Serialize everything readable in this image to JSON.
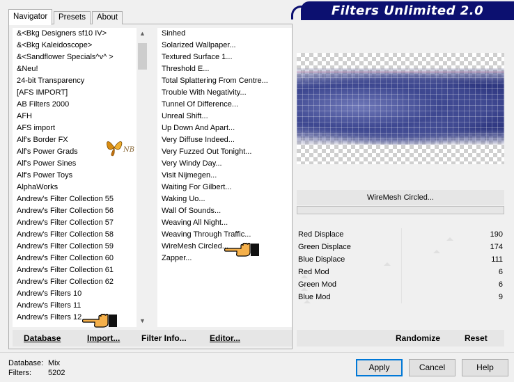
{
  "header": {
    "title": "Filters Unlimited 2.0"
  },
  "tabs": [
    {
      "label": "Navigator",
      "active": true
    },
    {
      "label": "Presets",
      "active": false
    },
    {
      "label": "About",
      "active": false
    }
  ],
  "categories": [
    "&<Bkg Designers sf10 IV>",
    "&<Bkg Kaleidoscope>",
    "&<Sandflower Specials^v^ >",
    "&Neu!",
    "24-bit Transparency",
    "[AFS IMPORT]",
    "AB Filters 2000",
    "AFH",
    "AFS import",
    "Alf's Border FX",
    "Alf's Power Grads",
    "Alf's Power Sines",
    "Alf's Power Toys",
    "AlphaWorks",
    "Andrew's Filter Collection 55",
    "Andrew's Filter Collection 56",
    "Andrew's Filter Collection 57",
    "Andrew's Filter Collection 58",
    "Andrew's Filter Collection 59",
    "Andrew's Filter Collection 60",
    "Andrew's Filter Collection 61",
    "Andrew's Filter Collection 62",
    "Andrew's Filters 10",
    "Andrew's Filters 11",
    "Andrew's Filters 12"
  ],
  "selected_category": "Andrew's Filters 12",
  "filters": [
    "Sinhed",
    "Solarized Wallpaper...",
    "Textured Surface 1...",
    "Threshold E...",
    "Total Splattering From Centre...",
    "Trouble With Negativity...",
    "Tunnel Of Difference...",
    "Unreal Shift...",
    "Up Down And Apart...",
    "Very Diffuse Indeed...",
    "Very Fuzzed Out Tonight...",
    "Very Windy Day...",
    "Visit Nijmegen...",
    "Waiting For Gilbert...",
    "Waking Uo...",
    "Wall Of Sounds...",
    "Weaving All Night...",
    "Weaving Through Traffic...",
    "WireMesh Circled...",
    "Zapper..."
  ],
  "selected_filter": "WireMesh Circled...",
  "filter_name": "WireMesh Circled...",
  "progress": 0,
  "params": [
    {
      "name": "Red Displace",
      "value": "190",
      "level": 0.745
    },
    {
      "name": "Green Displace",
      "value": "174",
      "level": 0.682
    },
    {
      "name": "Blue Displace",
      "value": "111",
      "level": 0.435
    },
    {
      "name": "Red Mod",
      "value": "6",
      "level": 0.02
    },
    {
      "name": "Green Mod",
      "value": "6",
      "level": 0.02
    },
    {
      "name": "Blue Mod",
      "value": "9",
      "level": 0.035
    }
  ],
  "left_buttons": {
    "database": "Database",
    "import": "Import...",
    "filter_info": "Filter Info...",
    "editor": "Editor..."
  },
  "right_buttons": {
    "randomize": "Randomize",
    "reset": "Reset"
  },
  "status": {
    "database_label": "Database:",
    "database_value": "Mix",
    "filters_label": "Filters:",
    "filters_value": "5202"
  },
  "dialog_buttons": {
    "apply": "Apply",
    "cancel": "Cancel",
    "help": "Help"
  },
  "colors": {
    "header_bg": "#0c1070",
    "header_text": "#ffffff",
    "default_button_border": "#0078d7"
  },
  "icons": {
    "scroll_up": "scroll-up-arrow-icon",
    "scroll_down": "scroll-down-arrow-icon",
    "hand_pointer": "hand-pointer-icon",
    "butterfly_logo": "butterfly-logo-icon"
  }
}
